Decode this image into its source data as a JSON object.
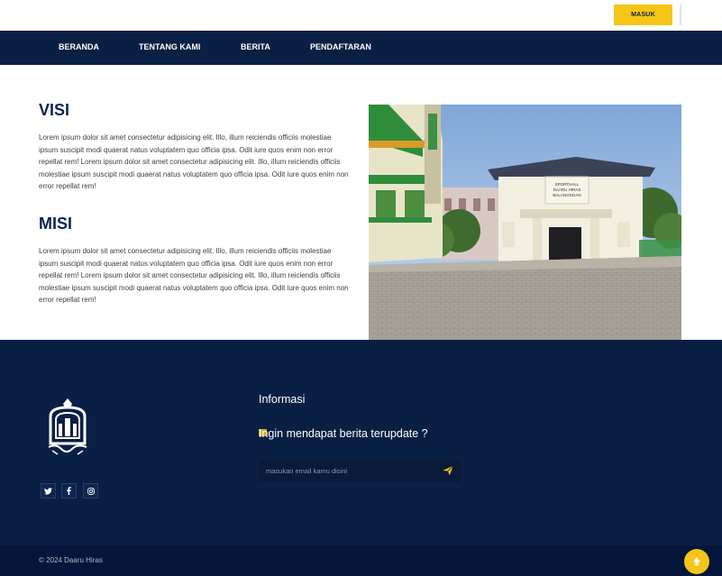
{
  "header": {
    "login_label": "MASUK"
  },
  "nav": {
    "items": [
      {
        "label": "BERANDA"
      },
      {
        "label": "TENTANG KAMI"
      },
      {
        "label": "BERITA"
      },
      {
        "label": "PENDAFTARAN"
      }
    ]
  },
  "visi": {
    "title": "VISI",
    "text": "Lorem ipsum dolor sit amet consectetur adipisicing elit. Illo, illum reiciendis officiis molestiae ipsum suscipit modi quaerat natus voluptatem quo officia ipsa. Odit iure quos enim non error repellat rem! Lorem ipsum dolor sit amet consectetur adipisicing elit. Illo, illum reiciendis officiis molestiae ipsum suscipit modi quaerat natus voluptatem quo officia ipsa. Odit iure quos enim non error repellat rem!"
  },
  "misi": {
    "title": "MISI",
    "text": "Lorem ipsum dolor sit amet consectetur adipisicing elit. Illo, illum reiciendis officiis molestiae ipsum suscipit modi quaerat natus voluptatem quo officia ipsa. Odit iure quos enim non error repellat rem! Lorem ipsum dolor sit amet consectetur adipisicing elit. Illo, illum reiciendis officiis molestiae ipsum suscipit modi quaerat natus voluptatem quo officia ipsa. Odit iure quos enim non error repellat rem!"
  },
  "photo": {
    "sign_lines": [
      "SPORTHALL",
      "DAARU HIRAS",
      "BALANGNGAN"
    ]
  },
  "footer": {
    "info_title": "Informasi",
    "subscribe_text": "Ingin mendapat berita terupdate ?",
    "email_placeholder": "masukan email kamu disini",
    "social_icons": [
      "twitter-icon",
      "facebook-icon",
      "instagram-icon"
    ],
    "copyright": "© 2024 Daaru Hiras"
  },
  "colors": {
    "navy": "#0a1f44",
    "accent": "#f5c518",
    "heading": "#0a2352"
  }
}
